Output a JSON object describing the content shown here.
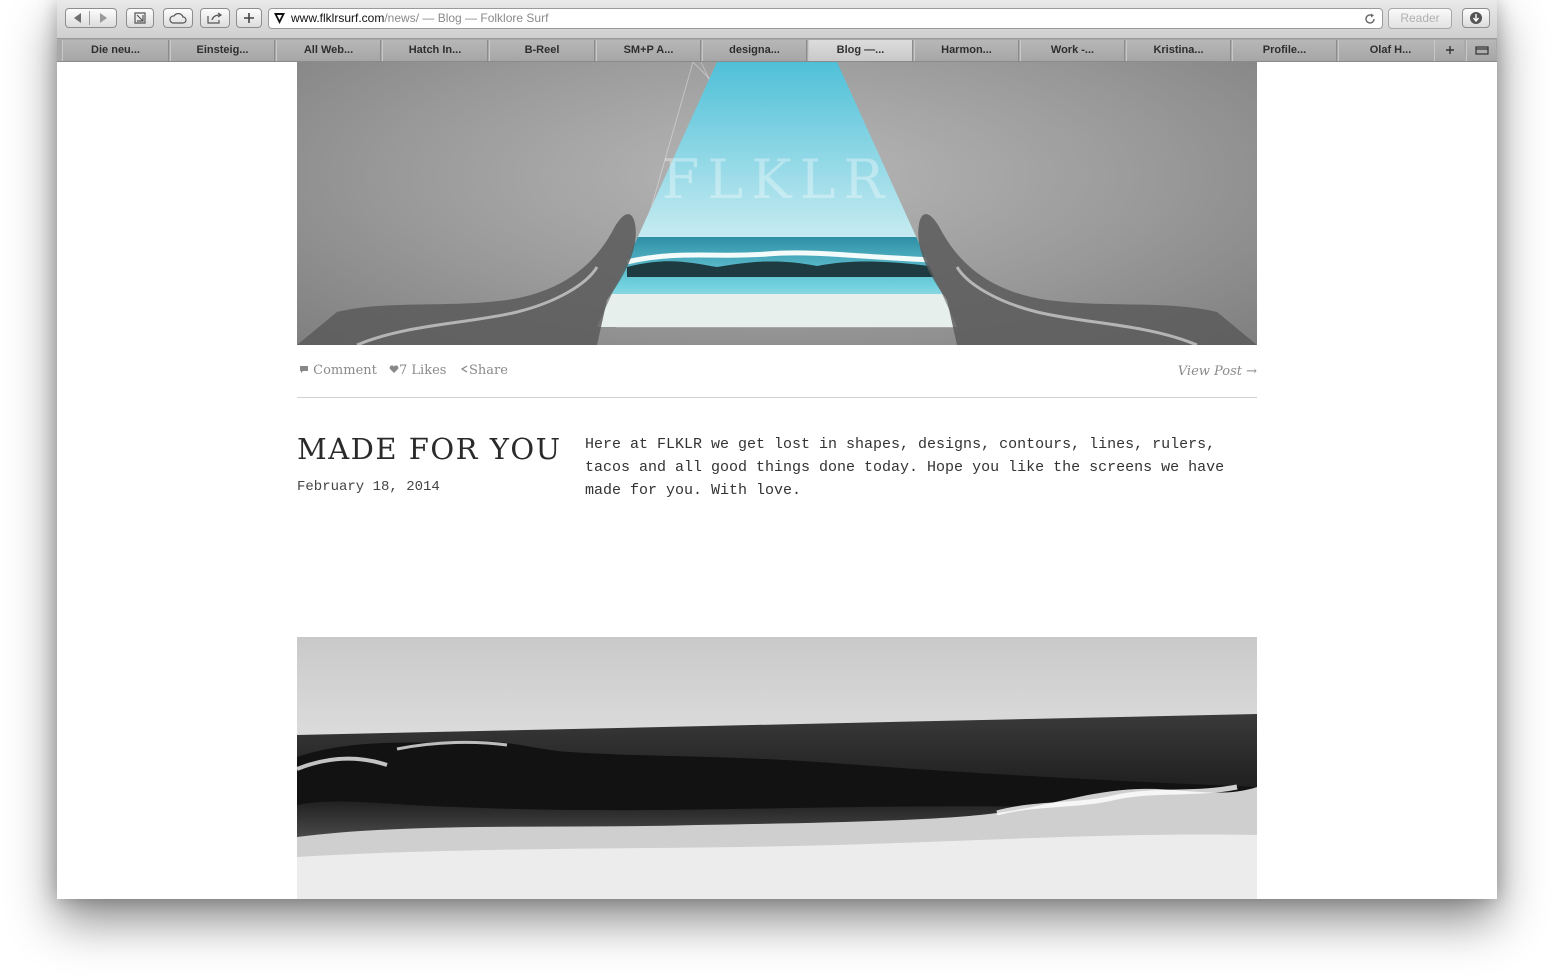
{
  "browser": {
    "url_domain": "www.flklrsurf.com",
    "url_path": "/news/",
    "page_title": " — Blog — Folklore Surf",
    "reader_label": "Reader",
    "tabs": [
      {
        "label": "Die neu..."
      },
      {
        "label": "Einsteig..."
      },
      {
        "label": "All Web..."
      },
      {
        "label": "Hatch In..."
      },
      {
        "label": "B-Reel"
      },
      {
        "label": "SM+P A..."
      },
      {
        "label": "designa..."
      },
      {
        "label": "Blog —..."
      },
      {
        "label": "Harmon..."
      },
      {
        "label": "Work -..."
      },
      {
        "label": "Kristina..."
      },
      {
        "label": "Profile..."
      },
      {
        "label": "Olaf H..."
      }
    ],
    "active_tab_index": 7
  },
  "hero": {
    "logo_text": "FLKLR"
  },
  "post_meta": {
    "comment_label": "Comment",
    "likes_label": "7 Likes",
    "share_label": "Share",
    "view_post_label": "View Post →"
  },
  "post": {
    "title": "MADE FOR YOU",
    "date": "February 18, 2014",
    "body": "Here at FLKLR we get lost in shapes, designs, contours, lines, rulers, tacos and all good things done today. Hope you like the screens we have made for you. With love."
  },
  "colors": {
    "ocean": "#5ec4d6",
    "sky": "#8fd6e4",
    "muted_text": "#8a8a8a"
  }
}
